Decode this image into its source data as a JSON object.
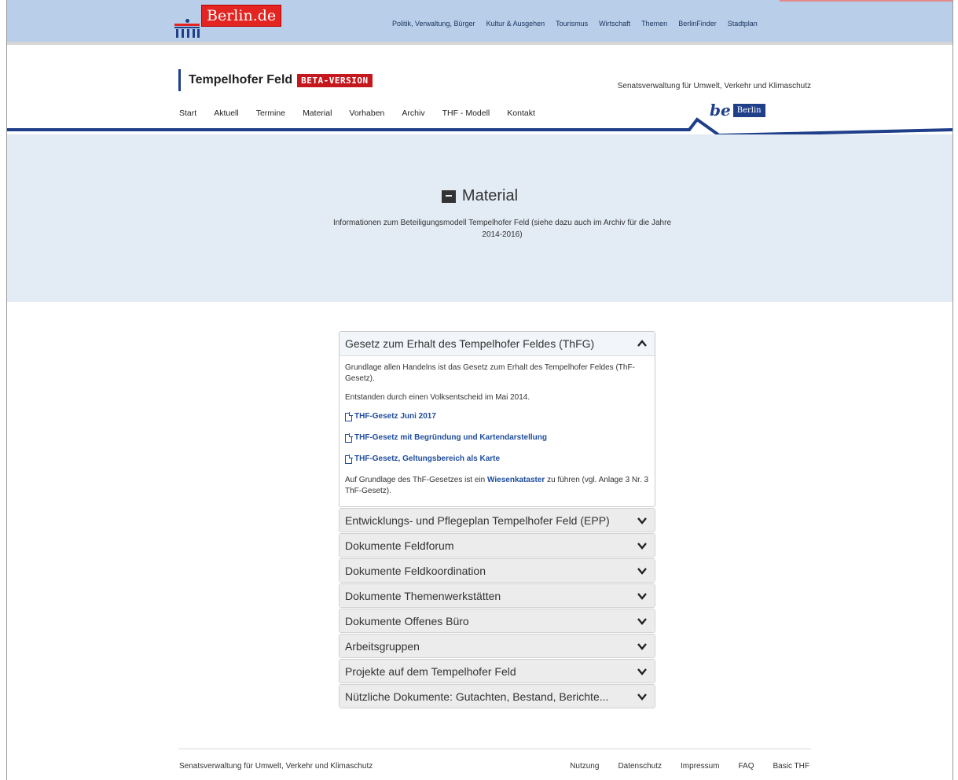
{
  "portal": {
    "logo_text_1": "Berlin",
    "logo_text_2": ".de",
    "nav": [
      "Politik, Verwaltung, Bürger",
      "Kultur & Ausgehen",
      "Tourismus",
      "Wirtschaft",
      "Themen",
      "BerlinFinder",
      "Stadtplan"
    ]
  },
  "site": {
    "title": "Tempelhofer Feld",
    "badge": "BETA-VERSION",
    "department": "Senatsverwaltung für Umwelt, Verkehr und Klimaschutz",
    "nav": [
      "Start",
      "Aktuell",
      "Termine",
      "Material",
      "Vorhaben",
      "Archiv",
      "THF - Modell",
      "Kontakt"
    ],
    "be_logo": "be",
    "be_logo_berlin": "Berlin"
  },
  "hero": {
    "title": "Material",
    "description": "Informationen zum Beteiligungsmodell Tempelhofer Feld (siehe dazu auch im Archiv für die Jahre 2014-2016)"
  },
  "accordion": {
    "open_section": {
      "title": "Gesetz zum Erhalt des Tempelhofer Feldes (ThFG)",
      "para1": "Grundlage allen Handelns ist das Gesetz zum Erhalt des Tempelhofer Feldes (ThF-Gesetz).",
      "para2": "Entstanden durch einen Volksentscheid im Mai 2014.",
      "links": [
        "THF-Gesetz Juni 2017",
        "THF-Gesetz mit Begründung und Kartendarstellung",
        "THF-Gesetz, Geltungsbereich als Karte"
      ],
      "para3_before": "Auf Grundlage des ThF-Gesetzes ist ein ",
      "para3_link": "Wiesenkataster",
      "para3_after": " zu führen (vgl. Anlage 3 Nr. 3 ThF-Gesetz)."
    },
    "sections": [
      "Entwicklungs- und Pflegeplan Tempelhofer Feld (EPP)",
      "Dokumente Feldforum",
      "Dokumente Feldkoordination",
      "Dokumente Themenwerkstätten",
      "Dokumente Offenes Büro",
      "Arbeitsgruppen",
      "Projekte auf dem Tempelhofer Feld",
      "Nützliche Dokumente: Gutachten, Bestand, Berichte..."
    ]
  },
  "footer": {
    "left": "Senatsverwaltung für Umwelt, Verkehr und Klimaschutz",
    "links": [
      "Nutzung",
      "Datenschutz",
      "Impressum",
      "FAQ",
      "Basic THF"
    ]
  },
  "colors": {
    "accent_blue": "#1f3f8a",
    "badge_red": "#c4181e",
    "hero_bg": "#e3ebf5",
    "portal_bg": "#b9cfe9"
  }
}
